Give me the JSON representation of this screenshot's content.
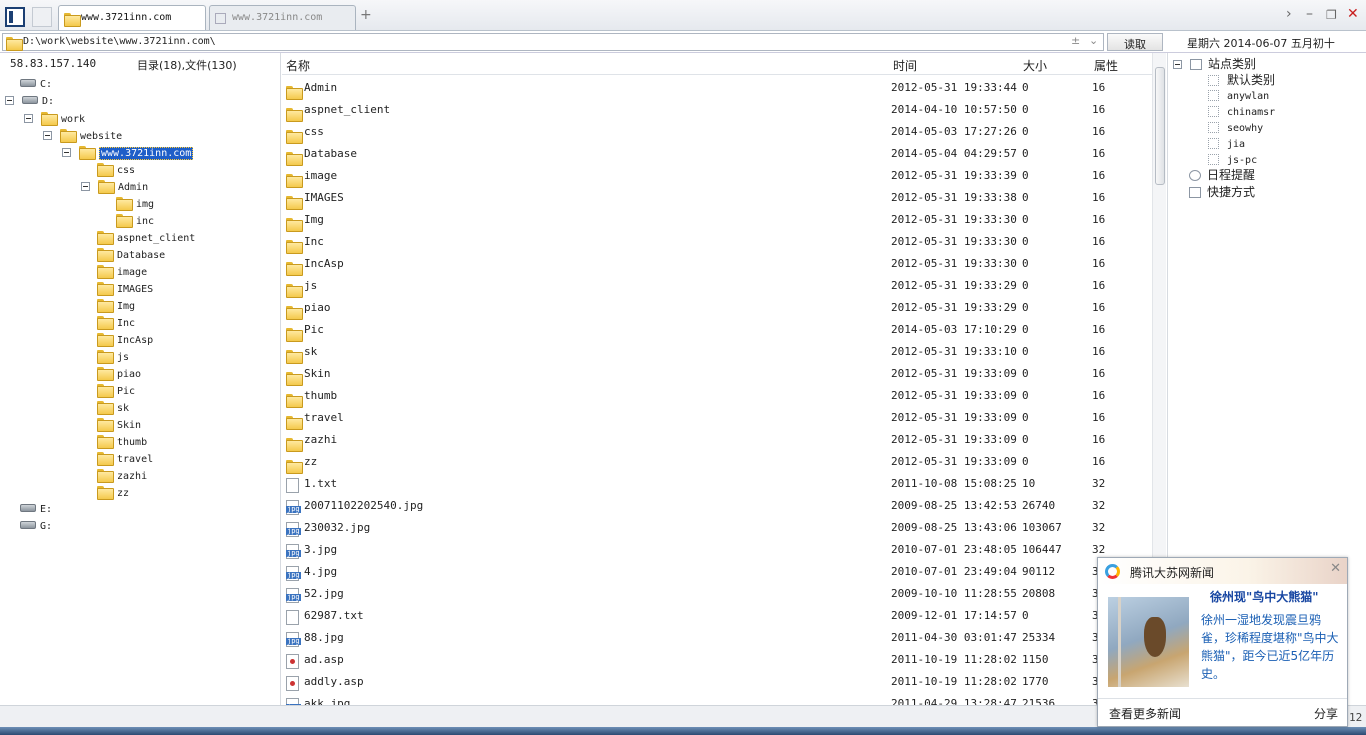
{
  "tabs": [
    {
      "label": "www.3721inn.com",
      "active": true
    },
    {
      "label": "www.3721inn.com",
      "active": false
    }
  ],
  "new_tab": "+",
  "window_controls": {
    "forward": "›",
    "minimize": "–",
    "restore": "❐",
    "close": "✕"
  },
  "address": {
    "path": "D:\\work\\website\\www.3721inn.com\\",
    "plusminus": "±",
    "dropdown": "⌄",
    "read_button": "读取"
  },
  "date_text": "星期六 2014-06-07 五月初十",
  "left_pane": {
    "ip": "58.83.157.140",
    "counts": "目录(18),文件(130)",
    "tree": [
      {
        "label": "C:",
        "kind": "drive"
      },
      {
        "label": "D:",
        "kind": "drive",
        "expanded": true
      },
      {
        "label": "work",
        "kind": "folder",
        "expanded": true
      },
      {
        "label": "website",
        "kind": "folder",
        "expanded": true
      },
      {
        "label": "www.3721inn.com",
        "kind": "folder",
        "expanded": true,
        "selected": true
      },
      {
        "label": "css",
        "kind": "folder"
      },
      {
        "label": "Admin",
        "kind": "folder",
        "expanded": true
      },
      {
        "label": "img",
        "kind": "folder"
      },
      {
        "label": "inc",
        "kind": "folder"
      },
      {
        "label": "aspnet_client",
        "kind": "folder"
      },
      {
        "label": "Database",
        "kind": "folder"
      },
      {
        "label": "image",
        "kind": "folder"
      },
      {
        "label": "IMAGES",
        "kind": "folder"
      },
      {
        "label": "Img",
        "kind": "folder"
      },
      {
        "label": "Inc",
        "kind": "folder"
      },
      {
        "label": "IncAsp",
        "kind": "folder"
      },
      {
        "label": "js",
        "kind": "folder"
      },
      {
        "label": "piao",
        "kind": "folder"
      },
      {
        "label": "Pic",
        "kind": "folder"
      },
      {
        "label": "sk",
        "kind": "folder"
      },
      {
        "label": "Skin",
        "kind": "folder"
      },
      {
        "label": "thumb",
        "kind": "folder"
      },
      {
        "label": "travel",
        "kind": "folder"
      },
      {
        "label": "zazhi",
        "kind": "folder"
      },
      {
        "label": "zz",
        "kind": "folder"
      },
      {
        "label": "E:",
        "kind": "drive"
      },
      {
        "label": "G:",
        "kind": "drive"
      }
    ]
  },
  "file_list": {
    "columns": {
      "name": "名称",
      "time": "时间",
      "size": "大小",
      "attr": "属性"
    },
    "rows": [
      {
        "name": "Admin",
        "time": "2012-05-31 19:33:44",
        "size": "0",
        "attr": "16",
        "type": "folder"
      },
      {
        "name": "aspnet_client",
        "time": "2014-04-10 10:57:50",
        "size": "0",
        "attr": "16",
        "type": "folder"
      },
      {
        "name": "css",
        "time": "2014-05-03 17:27:26",
        "size": "0",
        "attr": "16",
        "type": "folder"
      },
      {
        "name": "Database",
        "time": "2014-05-04 04:29:57",
        "size": "0",
        "attr": "16",
        "type": "folder"
      },
      {
        "name": "image",
        "time": "2012-05-31 19:33:39",
        "size": "0",
        "attr": "16",
        "type": "folder"
      },
      {
        "name": "IMAGES",
        "time": "2012-05-31 19:33:38",
        "size": "0",
        "attr": "16",
        "type": "folder"
      },
      {
        "name": "Img",
        "time": "2012-05-31 19:33:30",
        "size": "0",
        "attr": "16",
        "type": "folder"
      },
      {
        "name": "Inc",
        "time": "2012-05-31 19:33:30",
        "size": "0",
        "attr": "16",
        "type": "folder"
      },
      {
        "name": "IncAsp",
        "time": "2012-05-31 19:33:30",
        "size": "0",
        "attr": "16",
        "type": "folder"
      },
      {
        "name": "js",
        "time": "2012-05-31 19:33:29",
        "size": "0",
        "attr": "16",
        "type": "folder"
      },
      {
        "name": "piao",
        "time": "2012-05-31 19:33:29",
        "size": "0",
        "attr": "16",
        "type": "folder"
      },
      {
        "name": "Pic",
        "time": "2014-05-03 17:10:29",
        "size": "0",
        "attr": "16",
        "type": "folder"
      },
      {
        "name": "sk",
        "time": "2012-05-31 19:33:10",
        "size": "0",
        "attr": "16",
        "type": "folder"
      },
      {
        "name": "Skin",
        "time": "2012-05-31 19:33:09",
        "size": "0",
        "attr": "16",
        "type": "folder"
      },
      {
        "name": "thumb",
        "time": "2012-05-31 19:33:09",
        "size": "0",
        "attr": "16",
        "type": "folder"
      },
      {
        "name": "travel",
        "time": "2012-05-31 19:33:09",
        "size": "0",
        "attr": "16",
        "type": "folder"
      },
      {
        "name": "zazhi",
        "time": "2012-05-31 19:33:09",
        "size": "0",
        "attr": "16",
        "type": "folder"
      },
      {
        "name": "zz",
        "time": "2012-05-31 19:33:09",
        "size": "0",
        "attr": "16",
        "type": "folder"
      },
      {
        "name": "1.txt",
        "time": "2011-10-08 15:08:25",
        "size": "10",
        "attr": "32",
        "type": "file"
      },
      {
        "name": "20071102202540.jpg",
        "time": "2009-08-25 13:42:53",
        "size": "26740",
        "attr": "32",
        "type": "image"
      },
      {
        "name": "230032.jpg",
        "time": "2009-08-25 13:43:06",
        "size": "103067",
        "attr": "32",
        "type": "image"
      },
      {
        "name": "3.jpg",
        "time": "2010-07-01 23:48:05",
        "size": "106447",
        "attr": "32",
        "type": "image"
      },
      {
        "name": "4.jpg",
        "time": "2010-07-01 23:49:04",
        "size": "90112",
        "attr": "3",
        "type": "image"
      },
      {
        "name": "52.jpg",
        "time": "2009-10-10 11:28:55",
        "size": "20808",
        "attr": "3",
        "type": "image"
      },
      {
        "name": "62987.txt",
        "time": "2009-12-01 17:14:57",
        "size": "0",
        "attr": "3",
        "type": "file"
      },
      {
        "name": "88.jpg",
        "time": "2011-04-30 03:01:47",
        "size": "25334",
        "attr": "3",
        "type": "image"
      },
      {
        "name": "ad.asp",
        "time": "2011-10-19 11:28:02",
        "size": "1150",
        "attr": "3",
        "type": "asp"
      },
      {
        "name": "addly.asp",
        "time": "2011-10-19 11:28:02",
        "size": "1770",
        "attr": "3",
        "type": "asp"
      },
      {
        "name": "akk.jpg",
        "time": "2011-04-29 13:28:47",
        "size": "21536",
        "attr": "3",
        "type": "image"
      }
    ]
  },
  "right_pane": {
    "site_category": "站点类别",
    "sites": [
      "默认类别",
      "anywlan",
      "chinamsr",
      "seowhy",
      "jia",
      "js-pc"
    ],
    "schedule": "日程提醒",
    "shortcuts": "快捷方式"
  },
  "news_popup": {
    "source": "腾讯大苏网新闻",
    "close": "✕",
    "headline": "徐州现\"鸟中大熊猫\"",
    "body": "徐州一湿地发现震旦鸦雀，珍稀程度堪称\"鸟中大熊猫\"，距今已近5亿年历史。",
    "more": "查看更多新闻",
    "share": "分享"
  },
  "page_num": "12"
}
